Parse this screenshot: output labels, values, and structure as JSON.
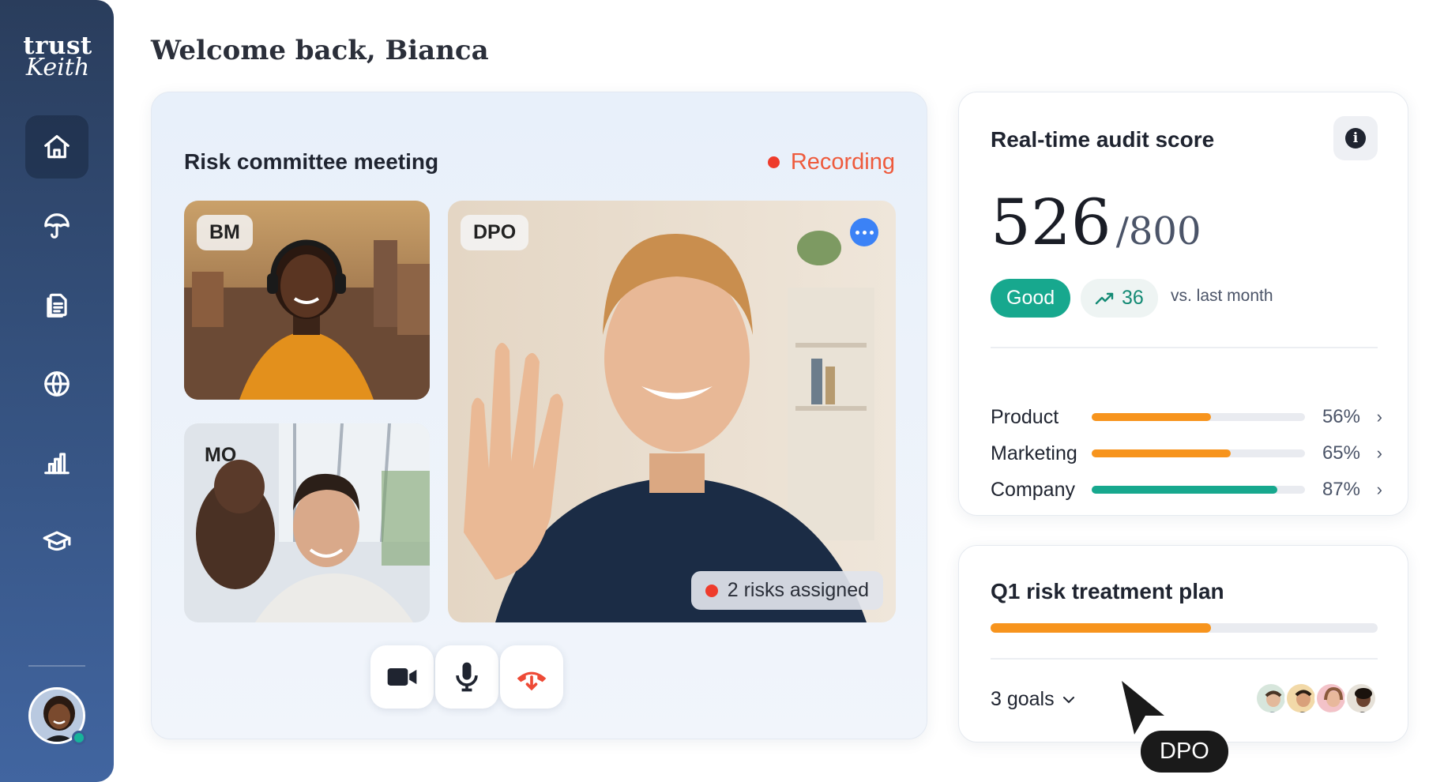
{
  "app": {
    "logo_line1": "trust",
    "logo_line2": "Keith"
  },
  "sidebar": {
    "items": [
      {
        "id": "home",
        "icon": "home-icon",
        "active": true
      },
      {
        "id": "risk",
        "icon": "umbrella-icon",
        "active": false
      },
      {
        "id": "documents",
        "icon": "documents-icon",
        "active": false
      },
      {
        "id": "global",
        "icon": "globe-icon",
        "active": false
      },
      {
        "id": "reports",
        "icon": "bar-chart-icon",
        "active": false
      },
      {
        "id": "training",
        "icon": "graduation-cap-icon",
        "active": false
      }
    ],
    "user_status": "online"
  },
  "greeting": "Welcome back, Bianca",
  "meeting": {
    "title": "Risk committee meeting",
    "status": "Recording",
    "participants": [
      {
        "initials": "BM"
      },
      {
        "initials": "MO"
      },
      {
        "initials": "DPO",
        "active_speaker": true
      }
    ],
    "risks_badge": "2 risks assigned",
    "controls": [
      "camera-icon",
      "microphone-icon",
      "hang-up-icon"
    ]
  },
  "audit": {
    "title": "Real-time audit score",
    "score": "526",
    "total": "/800",
    "rating": "Good",
    "trend_value": "36",
    "trend_caption": "vs. last month",
    "metrics": [
      {
        "label": "Product",
        "value": 56,
        "pct": "56%",
        "color": "#f7941d"
      },
      {
        "label": "Marketing",
        "value": 65,
        "pct": "65%",
        "color": "#f7941d"
      },
      {
        "label": "Company",
        "value": 87,
        "pct": "87%",
        "color": "#17a88e"
      }
    ]
  },
  "plan": {
    "title": "Q1 risk treatment plan",
    "progress": 0.57,
    "goals": "3 goals",
    "assignee_count": 4
  },
  "cursor": {
    "label": "DPO"
  },
  "colors": {
    "accent_orange": "#f7941d",
    "accent_teal": "#17a88e",
    "recording_red": "#ee3b2b",
    "sidebar": "#34507c"
  }
}
